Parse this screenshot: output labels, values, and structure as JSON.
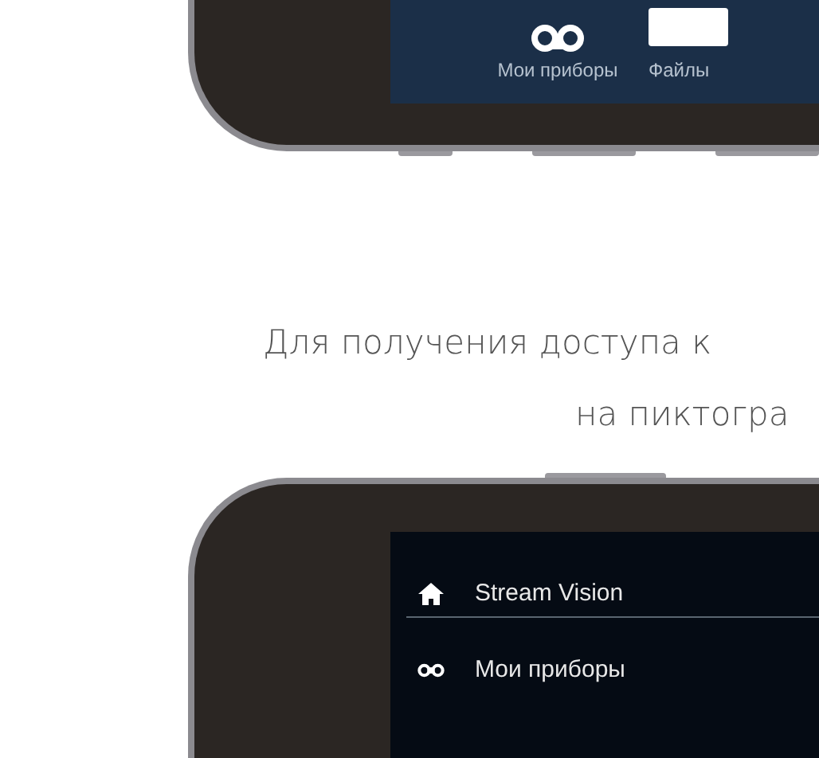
{
  "top_phone": {
    "tabs": [
      {
        "kind": "devices",
        "label": "Мои приборы"
      },
      {
        "kind": "files",
        "label": "Файлы"
      }
    ]
  },
  "instructions": [
    "Для получения доступа к",
    "на пиктогра"
  ],
  "bottom_phone": {
    "menu": [
      {
        "kind": "home",
        "label": "Stream Vision"
      },
      {
        "kind": "devices",
        "label": "Мои приборы"
      }
    ]
  }
}
